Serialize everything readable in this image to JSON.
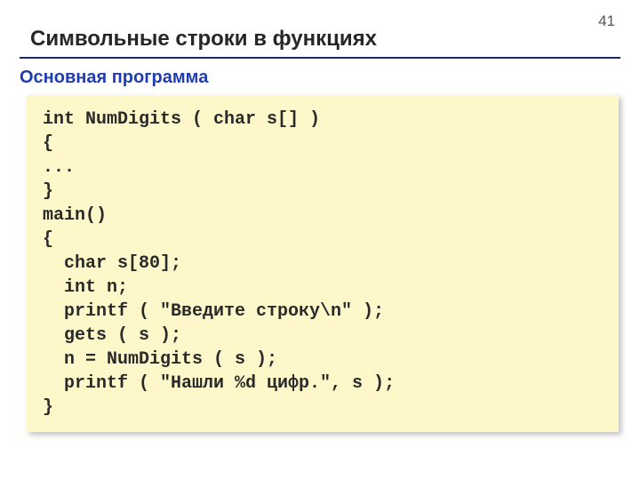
{
  "page_number": "41",
  "title": "Символьные строки в функциях",
  "subtitle": "Основная программа",
  "code": "int NumDigits ( char s[] )\n{\n...\n}\nmain()\n{\n  char s[80];\n  int n;\n  printf ( \"Введите строку\\n\" );\n  gets ( s );\n  n = NumDigits ( s );\n  printf ( \"Нашли %d цифр.\", s );\n}"
}
